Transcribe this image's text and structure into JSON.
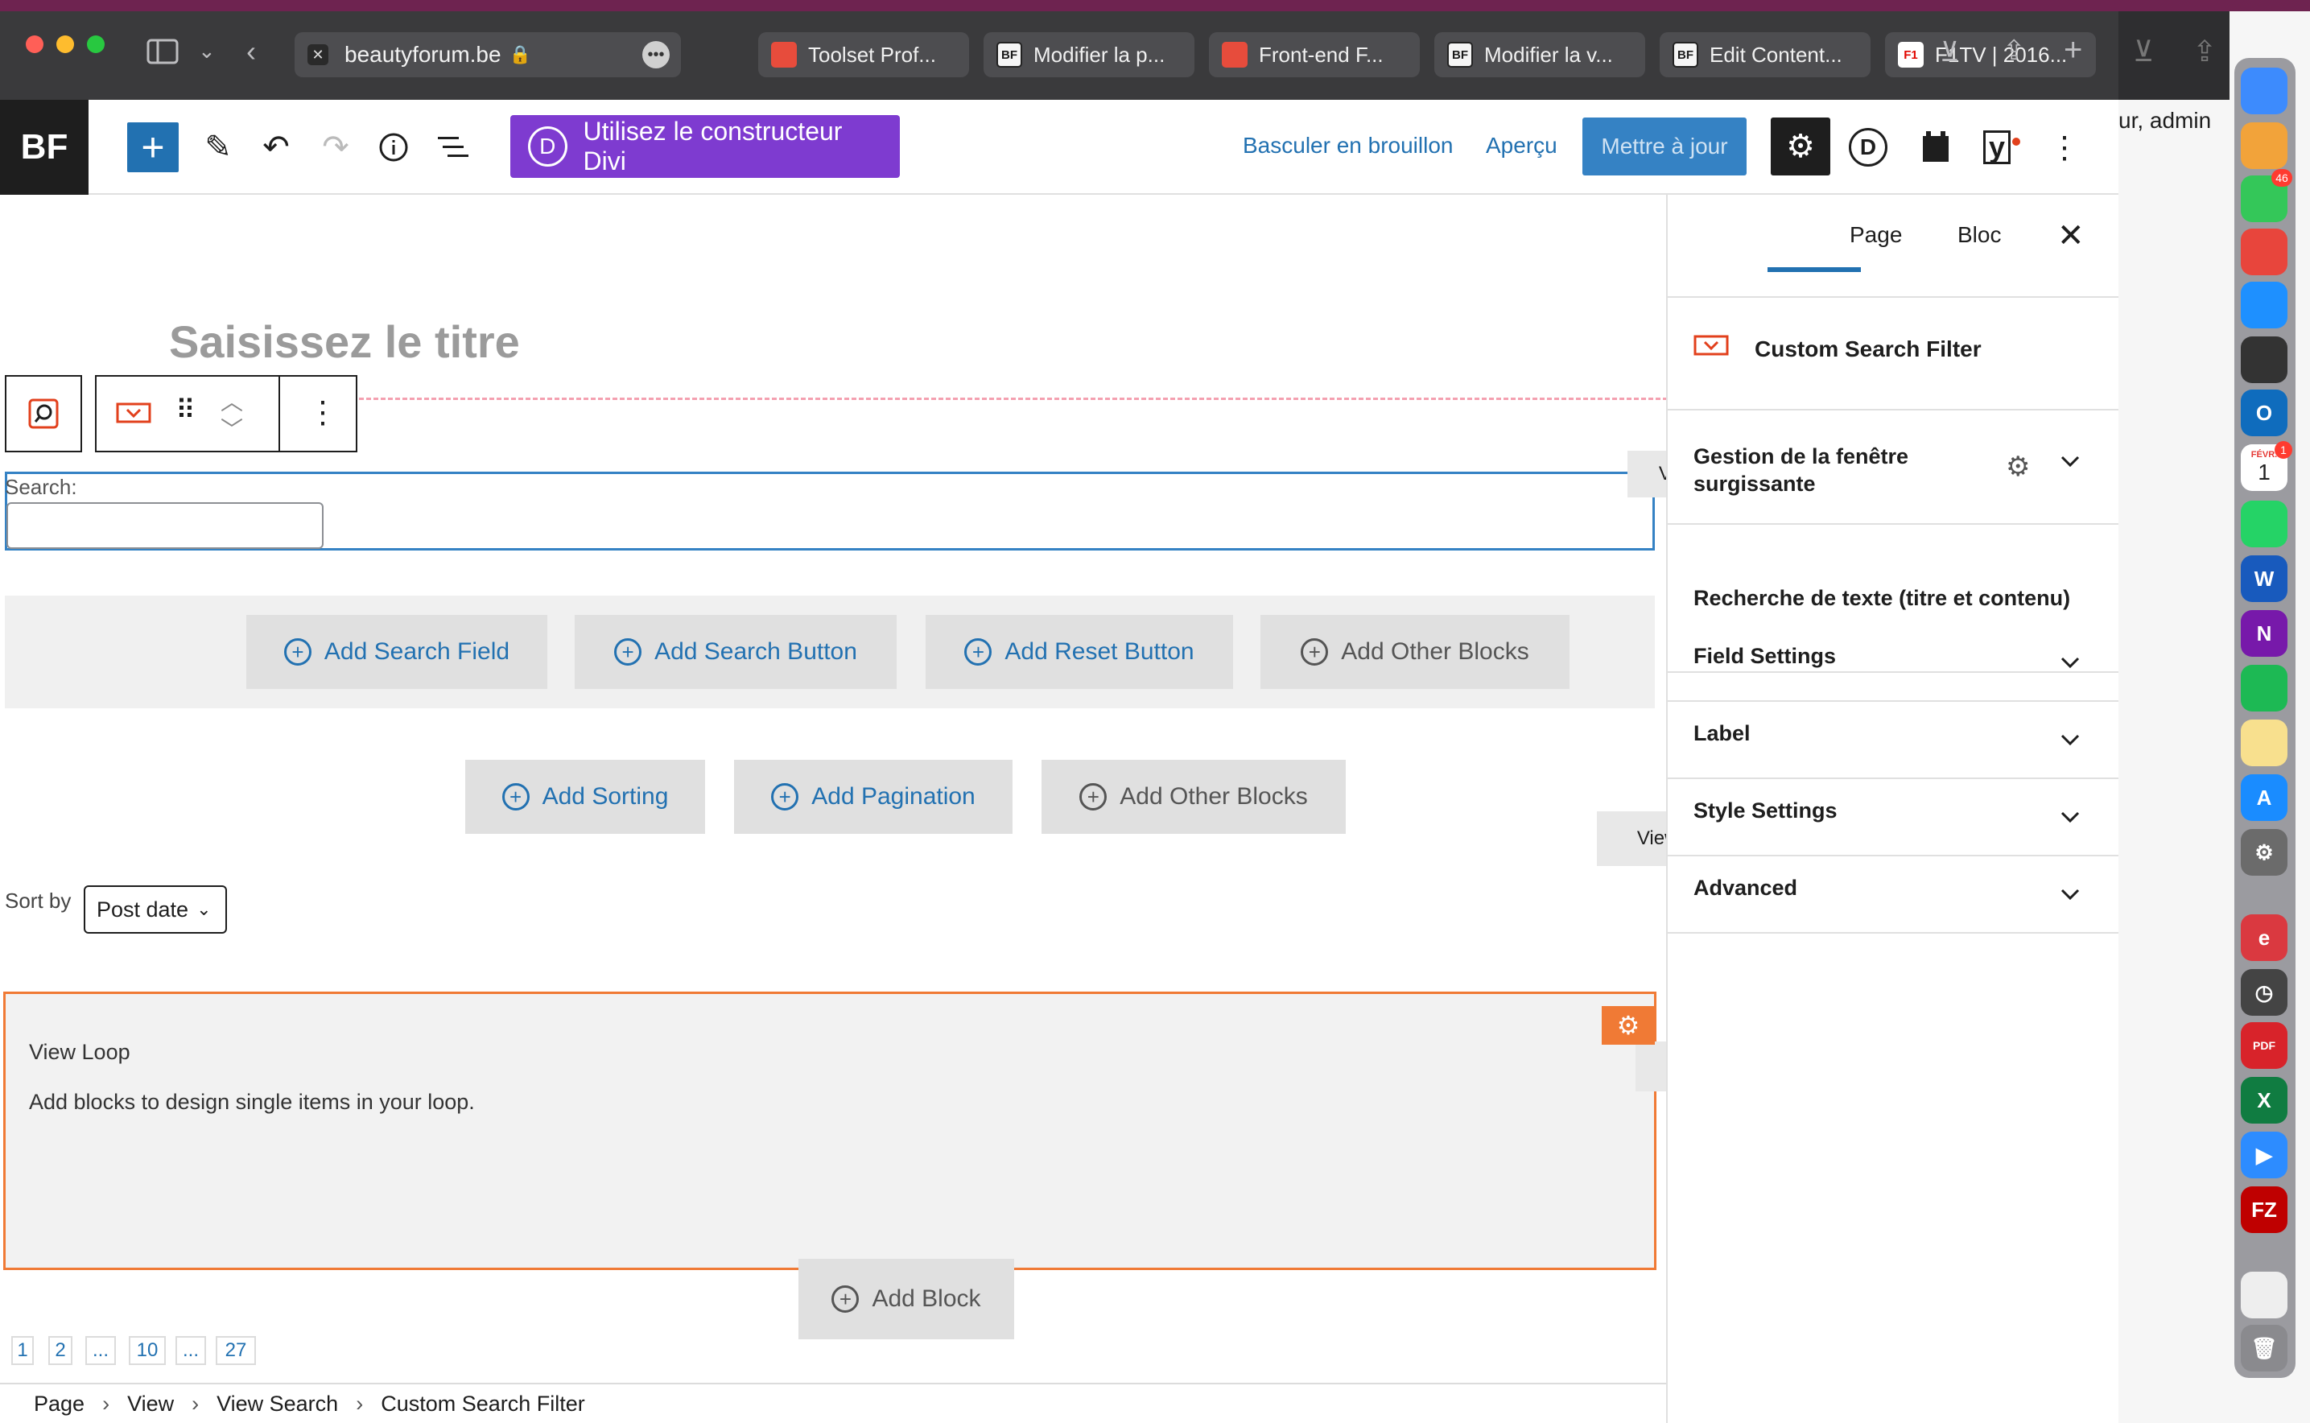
{
  "browser": {
    "url": "beautyforum.be",
    "tabs": [
      {
        "favicon": "red",
        "fav_text": "",
        "label": "Toolset Prof..."
      },
      {
        "favicon": "bf",
        "fav_text": "BF",
        "label": "Modifier la p..."
      },
      {
        "favicon": "red",
        "fav_text": "",
        "label": "Front-end F..."
      },
      {
        "favicon": "bf",
        "fav_text": "BF",
        "label": "Modifier la v..."
      },
      {
        "favicon": "bf",
        "fav_text": "BF",
        "label": "Edit Content..."
      },
      {
        "favicon": "f1",
        "fav_text": "F1",
        "label": "F1TV | 2016..."
      }
    ]
  },
  "outside": {
    "admin_text": "ur, admin"
  },
  "toolbar": {
    "logo": "BF",
    "divi_label": "Utilisez le constructeur Divi",
    "divi_letter": "D",
    "draft_link": "Basculer en brouillon",
    "preview_link": "Aperçu",
    "update_button": "Mettre à jour",
    "divi_icon_letter": "D",
    "yoast_letter": "y"
  },
  "editor": {
    "title_placeholder": "Saisissez le titre",
    "view_search_label": "View Search",
    "search_label": "Search:",
    "add_buttons_1": [
      "Add Search Field",
      "Add Search Button",
      "Add Reset Button",
      "Add Other Blocks"
    ],
    "view_output_label": "View Output",
    "add_buttons_2": [
      "Add Sorting",
      "Add Pagination",
      "Add Other Blocks"
    ],
    "sort_by_label": "Sort by",
    "sort_value": "Post date",
    "view_loop_tag": "View Loop",
    "loop_title": "View Loop",
    "loop_desc": "Add blocks to design single items in your loop.",
    "add_block": "Add Block",
    "pagination": [
      "1",
      "2",
      "...",
      "10",
      "...",
      "27"
    ],
    "breadcrumb": [
      "Page",
      "View",
      "View Search",
      "Custom Search Filter"
    ]
  },
  "sidebar": {
    "tab_page": "Page",
    "tab_bloc": "Bloc",
    "block_name": "Custom Search Filter",
    "popup_section": "Gestion de la fenêtre surgissante",
    "text_search": "Recherche de texte (titre et contenu)",
    "sections": [
      "Field Settings",
      "Label",
      "Style Settings",
      "Advanced"
    ]
  },
  "dock": {
    "messages_badge": "46",
    "calendar_badge": "1",
    "calendar_month": "FÉVR.",
    "calendar_day": "1"
  },
  "colors": {
    "accent": "#2271b1",
    "divi": "#7e3bd0",
    "loop_border": "#f07a35",
    "update": "#3582c4"
  }
}
